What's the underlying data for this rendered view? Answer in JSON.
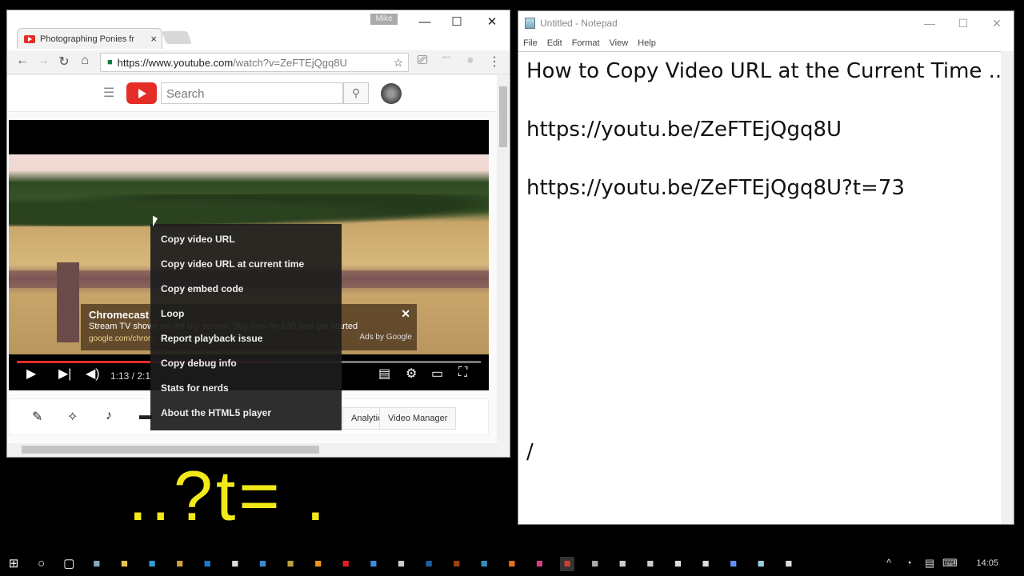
{
  "chrome": {
    "tab_title": "Photographing Ponies fr",
    "profile_name": "Mike",
    "url_scheme_host": "https://www.youtube.com",
    "url_path": "/watch?v=ZeFTEjQgq8U",
    "window_controls": {
      "minimize": "—",
      "maximize": "☐",
      "close": "✕"
    },
    "nav": {
      "back": "←",
      "forward": "→",
      "reload": "↻",
      "home": "⌂",
      "star": "☆",
      "cast": "⎚",
      "menu": "⋮"
    }
  },
  "youtube": {
    "search_placeholder": "Search",
    "search_icon": "⚲",
    "player": {
      "time_display": "1:13 / 2:1",
      "progress_fraction": 0.55,
      "ad": {
        "title": "Chromecast",
        "description": "Stream TV shows on the big screen. Buy now for £30 and get started",
        "url": "google.com/chrom",
        "attribution": "Ads by Google",
        "close": "✕"
      }
    },
    "action_buttons": [
      "Analytics",
      "Video Manager"
    ],
    "context_menu": [
      "Copy video URL",
      "Copy video URL at current time",
      "Copy embed code",
      "Loop",
      "Report playback issue",
      "Copy debug info",
      "Stats for nerds",
      "About the HTML5 player"
    ]
  },
  "overlay_text": "..?t= .",
  "notepad": {
    "title": "Untitled - Notepad",
    "menu": [
      "File",
      "Edit",
      "Format",
      "View",
      "Help"
    ],
    "content": "How to Copy Video URL at the Current Time ...\n\nhttps://youtu.be/ZeFTEjQgq8U\n\nhttps://youtu.be/ZeFTEjQgq8U?t=73\n\n\n\n\n\n\n\n\n/"
  },
  "taskbar": {
    "clock": "14:05",
    "apps": [
      "start",
      "cortana",
      "task-view",
      "resource-monitor",
      "file-explorer",
      "music",
      "media-player",
      "edge",
      "google",
      "remote-desktop",
      "paint-tool",
      "vlc",
      "opera",
      "skype",
      "paintshop",
      "photoshop",
      "bridge",
      "video-editor",
      "firefox",
      "picasa",
      "chrome",
      "audio-tool",
      "obs",
      "globe",
      "camera",
      "calculator",
      "rocket",
      "notepad",
      "alarm"
    ]
  }
}
